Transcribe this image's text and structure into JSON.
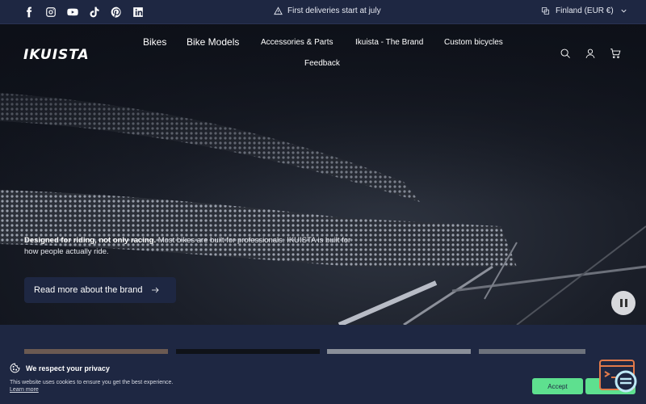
{
  "topbar": {
    "socials": [
      "facebook-icon",
      "instagram-icon",
      "youtube-icon",
      "tiktok-icon",
      "pinterest-icon",
      "linkedin-icon"
    ],
    "announcement": "First deliveries start at july",
    "locale": "Finland (EUR €)"
  },
  "header": {
    "logo": "IKUISTA",
    "nav": [
      {
        "label": "Bikes"
      },
      {
        "label": "Bike Models"
      },
      {
        "label": "Accessories & Parts"
      },
      {
        "label": "Ikuista - The Brand"
      },
      {
        "label": "Custom bicycles"
      },
      {
        "label": "Feedback"
      }
    ],
    "icons": [
      "search-icon",
      "account-icon",
      "cart-icon"
    ]
  },
  "hero": {
    "text_bold": "Designed for riding, not only racing.",
    "text_rest": " Most bikes are built for professionals. IKUISTA is built for how people actually ride.",
    "cta_label": "Read more about the brand"
  },
  "cookie": {
    "title": "We respect your privacy",
    "text": "This website uses cookies to ensure you get the best experience.",
    "link": "Learn more",
    "accept": "Accept",
    "decline": "Decline"
  },
  "colors": {
    "navy": "#1e2742",
    "accent_green": "#5ee08f"
  }
}
